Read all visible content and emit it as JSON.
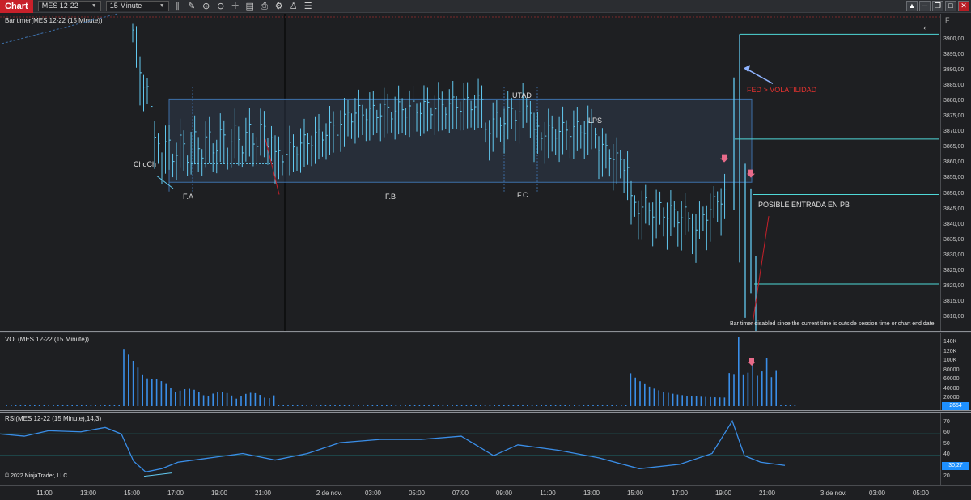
{
  "toolbar": {
    "title": "Chart",
    "instrument": "MES 12-22",
    "interval": "15 Minute",
    "icons": [
      "bar-type-icon",
      "drawing-tool-icon",
      "zoom-in-icon",
      "zoom-out-icon",
      "crosshair-icon",
      "data-box-icon",
      "snapshot-icon",
      "properties-icon",
      "strategy-icon",
      "list-icon"
    ]
  },
  "window": {
    "menu": "▲",
    "minimize": "─",
    "restore": "❐",
    "maximize": "□",
    "close": "✕"
  },
  "price_panel": {
    "label": "Bar timer(MES 12-22 (15 Minute))",
    "axis_hint": "F",
    "price_ticks": [
      "3900,00",
      "3895,00",
      "3890,00",
      "3885,00",
      "3880,00",
      "3875,00",
      "3870,00",
      "3865,00",
      "3860,00",
      "3855,00",
      "3850,00",
      "3845,00",
      "3840,00",
      "3835,00",
      "3830,00",
      "3825,00",
      "3820,00",
      "3815,00",
      "3810,00"
    ],
    "status_note": "Bar timer disabled since the current time is outside session time or chart end date",
    "annotations": {
      "choch": "ChoCh",
      "fa": "F.A",
      "fb": "F.B",
      "fc": "F.C",
      "utad": "UTAD",
      "lps": "LPS",
      "fed": "FED > VOLATILIDAD",
      "entry": "POSIBLE ENTRADA EN PB"
    },
    "colors": {
      "bars": "#62c9f0",
      "range_box": "#3d6fa8",
      "horizontal_lines": "#4fd8d8",
      "fed_text": "#e5322f",
      "arrow": "#e86b8a"
    }
  },
  "volume_panel": {
    "label": "VOL(MES 12-22 (15 Minute))",
    "ticks": [
      "140K",
      "120K",
      "100K",
      "80000",
      "60000",
      "40000",
      "20000"
    ],
    "current_value": "2654"
  },
  "rsi_panel": {
    "label": "RSI(MES 12-22 (15 Minute),14,3)",
    "ticks": [
      "70",
      "60",
      "50",
      "40",
      "30",
      "20"
    ],
    "current_value": "30,27",
    "copyright": "© 2022 NinjaTrader, LLC"
  },
  "time_axis": {
    "labels": [
      "11:00",
      "13:00",
      "15:00",
      "17:00",
      "19:00",
      "21:00",
      "2 de nov.",
      "03:00",
      "05:00",
      "07:00",
      "09:00",
      "11:00",
      "13:00",
      "15:00",
      "17:00",
      "19:00",
      "21:00",
      "3 de nov.",
      "03:00",
      "05:00"
    ]
  }
}
